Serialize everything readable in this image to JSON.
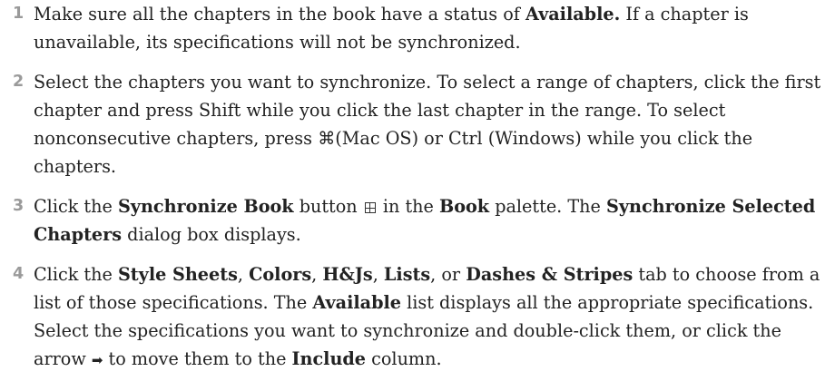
{
  "steps": [
    {
      "number": "1",
      "parts": {
        "a": "Make sure all the chapters in the book have a status of ",
        "b_available": "Available.",
        "c": " If a chapter is unavailable, its specifications will not be synchronized."
      }
    },
    {
      "number": "2",
      "parts": {
        "a": "Select the chapters you want to synchronize. To select a range of chapters, click the first chapter and press Shift while you click the last chapter in the range. To select nonconsecutive chapters, press ",
        "cmd_symbol": "⌘",
        "b": "(Mac OS) or Ctrl (Windows) while you click the chapters."
      }
    },
    {
      "number": "3",
      "parts": {
        "a": "Click the ",
        "b_sync_book": "Synchronize Book",
        "c": " button ",
        "d": " in the ",
        "b_book": "Book",
        "e": " palette. The ",
        "b_dialog": "Synchronize Selected Chapters",
        "f": " dialog box displays."
      }
    },
    {
      "number": "4",
      "parts": {
        "a": "Click the ",
        "b_style_sheets": "Style Sheets",
        "sep1": ", ",
        "b_colors": "Colors",
        "sep2": ", ",
        "b_hjs": "H&Js",
        "sep3": ", ",
        "b_lists": "Lists",
        "c": ", or ",
        "b_dashes": "Dashes & Stripes",
        "d": " tab to choose from a list of those specifications. The ",
        "b_available": "Available",
        "e": " list displays all the appropriate specifications. Select the specifications you want to synchronize and double-click them, or click the arrow ",
        "arrow_symbol": "➡",
        "f": " to move them to the ",
        "b_include": "Include",
        "g": " column."
      }
    }
  ]
}
